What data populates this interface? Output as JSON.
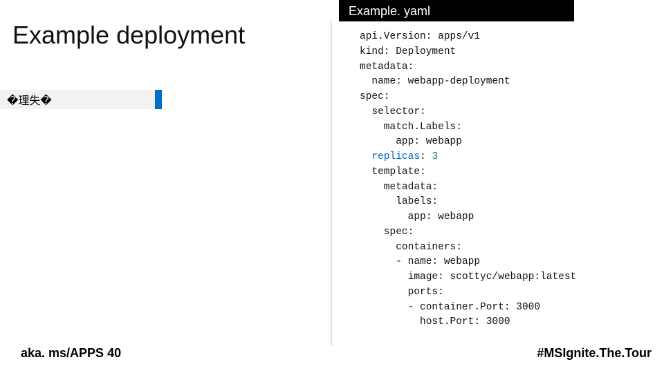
{
  "title": "Example deployment",
  "placeholder": "�理失�",
  "code_header": "Example. yaml",
  "code_lines": [
    "api.Version: apps/v1",
    "kind: Deployment",
    "metadata:",
    "  name: webapp-deployment",
    "spec:",
    "  selector:",
    "    match.Labels:",
    "      app: webapp",
    "  replicas: 3",
    "  template:",
    "    metadata:",
    "      labels:",
    "        app: webapp",
    "    spec:",
    "      containers:",
    "      - name: webapp",
    "        image: scottyc/webapp:latest",
    "        ports:",
    "        - container.Port: 3000",
    "          host.Port: 3000"
  ],
  "footer_left": "aka. ms/APPS 40",
  "footer_right": "#MSIgnite.The.Tour"
}
